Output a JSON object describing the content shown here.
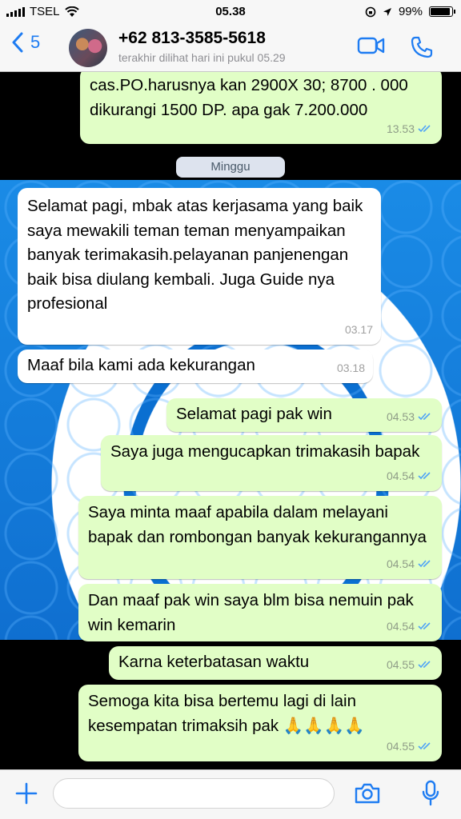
{
  "status_bar": {
    "carrier": "TSEL",
    "time": "05.38",
    "battery": "99%",
    "battery_level": 0.99
  },
  "header": {
    "back_count": "5",
    "contact_name": "+62 813-3585-5618",
    "last_seen": "terakhir dilihat hari ini pukul 05.29",
    "accent": "#1e7cf2"
  },
  "chat": {
    "day_label": "Minggu",
    "messages": [
      {
        "dir": "out",
        "text": "cas.PO.harusnya kan 2900X 30; 8700 . 000 dikurangi 1500 DP. apa gak 7.200.000",
        "time": "13.53"
      },
      {
        "dir": "in",
        "text": "Selamat pagi, mbak atas kerjasama yang baik saya mewakili teman teman menyampaikan banyak terimakasih.pelayanan panjenengan baik bisa diulang kembali. Juga Guide nya profesional",
        "time": "03.17"
      },
      {
        "dir": "in",
        "text": "Maaf bila kami ada kekurangan",
        "time": "03.18"
      },
      {
        "dir": "out",
        "text": "Selamat pagi pak win",
        "time": "04.53"
      },
      {
        "dir": "out",
        "text": "Saya juga mengucapkan trimakasih bapak",
        "time": "04.54"
      },
      {
        "dir": "out",
        "text": "Saya minta maaf apabila dalam melayani bapak dan rombongan banyak kekurangannya",
        "time": "04.54"
      },
      {
        "dir": "out",
        "text": "Dan maaf pak win saya blm bisa nemuin pak win kemarin",
        "time": "04.54"
      },
      {
        "dir": "out",
        "text": "Karna keterbatasan waktu",
        "time": "04.55"
      },
      {
        "dir": "out",
        "text": "Semoga kita bisa bertemu lagi di lain kesempatan trimaksih pak 🙏🙏🙏🙏",
        "time": "04.55"
      }
    ]
  },
  "input": {
    "placeholder": ""
  },
  "colors": {
    "outgoing_bubble": "#e1fec6",
    "incoming_bubble": "#ffffff",
    "read_ticks": "#4fa3f7"
  }
}
